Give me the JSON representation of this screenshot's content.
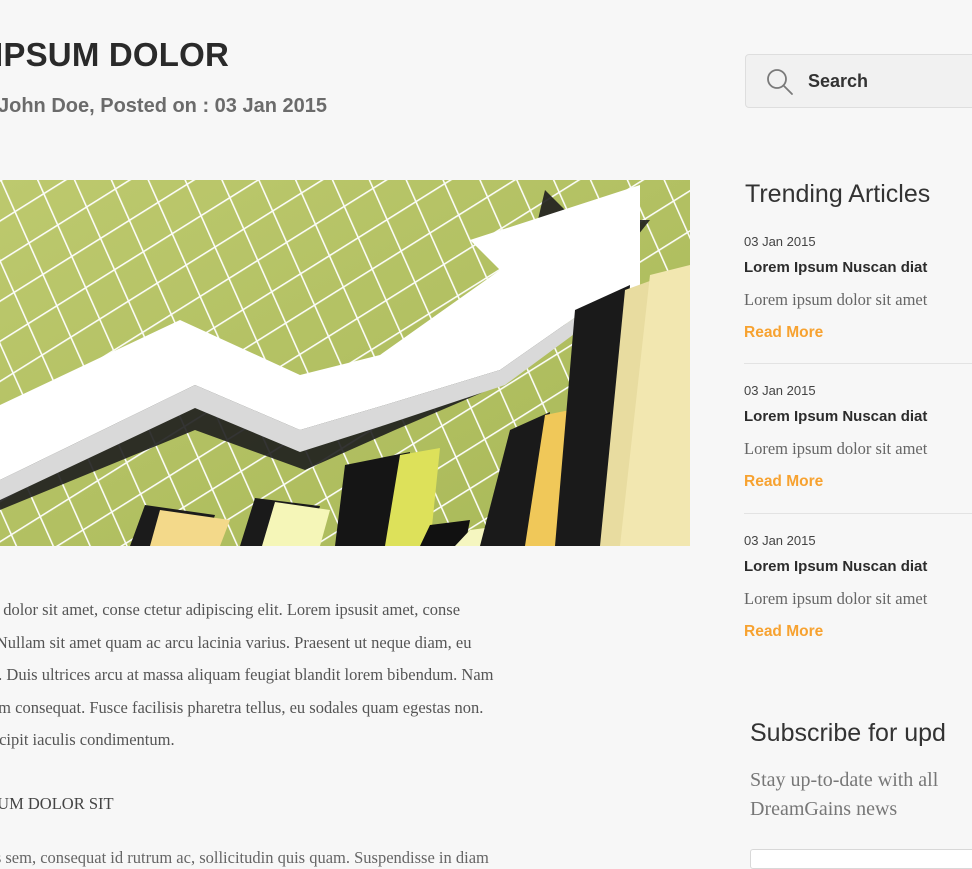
{
  "post": {
    "title": "IPSUM DOLOR",
    "meta": "John Doe, Posted on : 03 Jan 2015",
    "paragraph_lines": [
      "um dolor sit amet, conse ctetur adipiscing elit. Lorem ipsusit amet, conse",
      "lit Nullam sit amet quam ac arcu lacinia varius. Praesent ut neque diam, eu",
      "em. Duis ultrices arcu at massa aliquam feugiat blandit lorem bibendum. Nam",
      "etum consequat. Fusce facilisis pharetra tellus, eu sodales quam egestas non.",
      " suscipit iaculis condimentum."
    ],
    "subheading": "SUM DOLOR SIT",
    "cut_line": "pis sem, consequat id rutrum ac, sollicitudin quis quam. Suspendisse in diam"
  },
  "sidebar": {
    "search_placeholder": "Search",
    "trending_heading": "Trending Articles",
    "articles": [
      {
        "date": "03 Jan 2015",
        "title": "Lorem Ipsum Nuscan diat",
        "excerpt": "Lorem ipsum dolor sit amet",
        "link": "Read More"
      },
      {
        "date": "03 Jan 2015",
        "title": "Lorem Ipsum Nuscan diat",
        "excerpt": "Lorem ipsum dolor sit amet",
        "link": "Read More"
      },
      {
        "date": "03 Jan 2015",
        "title": "Lorem Ipsum Nuscan diat",
        "excerpt": "Lorem ipsum dolor sit amet",
        "link": "Read More"
      }
    ],
    "subscribe_heading": "Subscribe for upd",
    "subscribe_text": "Stay up-to-date with all DreamGains news"
  },
  "colors": {
    "accent": "#f7a230",
    "hero_background": "#b9c66a"
  },
  "icons": {
    "search": "search-icon",
    "hero": "growth-chart-illustration"
  }
}
